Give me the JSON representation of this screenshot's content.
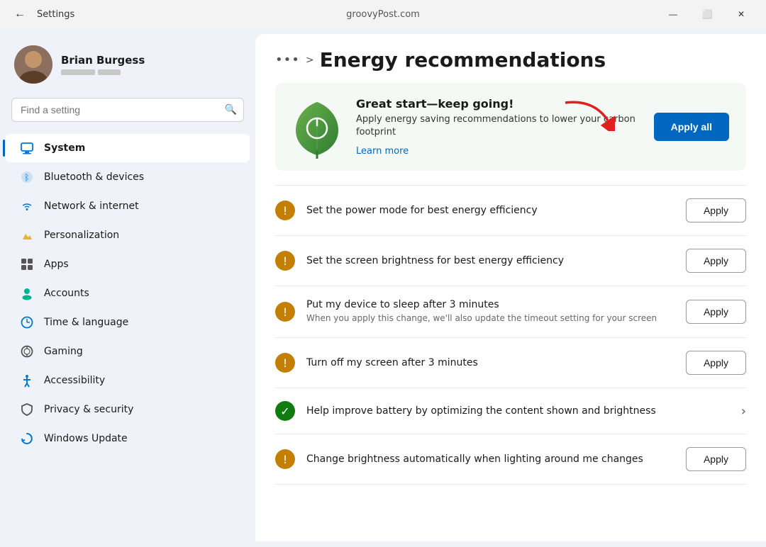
{
  "titlebar": {
    "back_label": "←",
    "app_name": "Settings",
    "url": "groovyPost.com",
    "minimize": "—",
    "maximize": "⬜",
    "close": "✕"
  },
  "sidebar": {
    "search_placeholder": "Find a setting",
    "user": {
      "name": "Brian Burgess"
    },
    "nav_items": [
      {
        "id": "system",
        "label": "System",
        "active": true
      },
      {
        "id": "bluetooth",
        "label": "Bluetooth & devices",
        "active": false
      },
      {
        "id": "network",
        "label": "Network & internet",
        "active": false
      },
      {
        "id": "personalization",
        "label": "Personalization",
        "active": false
      },
      {
        "id": "apps",
        "label": "Apps",
        "active": false
      },
      {
        "id": "accounts",
        "label": "Accounts",
        "active": false
      },
      {
        "id": "time",
        "label": "Time & language",
        "active": false
      },
      {
        "id": "gaming",
        "label": "Gaming",
        "active": false
      },
      {
        "id": "accessibility",
        "label": "Accessibility",
        "active": false
      },
      {
        "id": "privacy",
        "label": "Privacy & security",
        "active": false
      },
      {
        "id": "update",
        "label": "Windows Update",
        "active": false
      }
    ]
  },
  "content": {
    "breadcrumb_dots": "•••",
    "breadcrumb_arrow": ">",
    "page_title": "Energy recommendations",
    "hero": {
      "title": "Great start—keep going!",
      "subtitle": "Apply energy saving recommendations to lower your carbon footprint",
      "link_text": "Learn more",
      "apply_all_label": "Apply all"
    },
    "recommendations": [
      {
        "id": "power-mode",
        "status": "warning",
        "title": "Set the power mode for best energy efficiency",
        "subtitle": "",
        "action": "apply",
        "apply_label": "Apply"
      },
      {
        "id": "screen-brightness",
        "status": "warning",
        "title": "Set the screen brightness for best energy efficiency",
        "subtitle": "",
        "action": "apply",
        "apply_label": "Apply"
      },
      {
        "id": "sleep",
        "status": "warning",
        "title": "Put my device to sleep after 3 minutes",
        "subtitle": "When you apply this change, we'll also update the timeout setting for your screen",
        "action": "apply",
        "apply_label": "Apply"
      },
      {
        "id": "screen-off",
        "status": "warning",
        "title": "Turn off my screen after 3 minutes",
        "subtitle": "",
        "action": "apply",
        "apply_label": "Apply"
      },
      {
        "id": "battery",
        "status": "success",
        "title": "Help improve battery by optimizing the content shown and brightness",
        "subtitle": "",
        "action": "chevron",
        "apply_label": ""
      },
      {
        "id": "auto-brightness",
        "status": "warning",
        "title": "Change brightness automatically when lighting around me changes",
        "subtitle": "",
        "action": "apply",
        "apply_label": "Apply"
      }
    ]
  }
}
